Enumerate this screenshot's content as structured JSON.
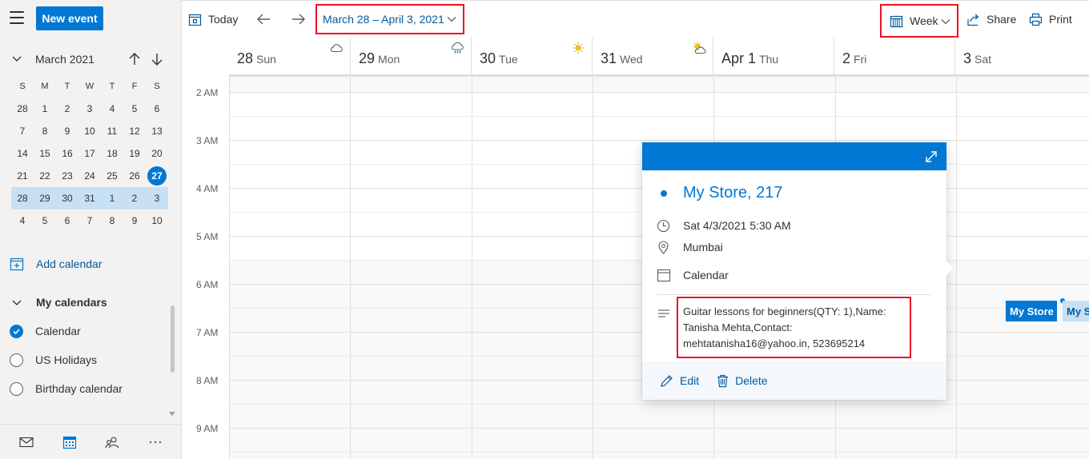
{
  "sidebar": {
    "new_event_label": "New event",
    "mini_month_title": "March 2021",
    "dow": [
      "S",
      "M",
      "T",
      "W",
      "T",
      "F",
      "S"
    ],
    "weeks": [
      [
        "28",
        "1",
        "2",
        "3",
        "4",
        "5",
        "6"
      ],
      [
        "7",
        "8",
        "9",
        "10",
        "11",
        "12",
        "13"
      ],
      [
        "14",
        "15",
        "16",
        "17",
        "18",
        "19",
        "20"
      ],
      [
        "21",
        "22",
        "23",
        "24",
        "25",
        "26",
        "27"
      ],
      [
        "28",
        "29",
        "30",
        "31",
        "1",
        "2",
        "3"
      ],
      [
        "4",
        "5",
        "6",
        "7",
        "8",
        "9",
        "10"
      ]
    ],
    "today": "27",
    "add_calendar_label": "Add calendar",
    "my_calendars_label": "My calendars",
    "calendars": [
      {
        "name": "Calendar",
        "checked": true
      },
      {
        "name": "US Holidays",
        "checked": false
      },
      {
        "name": "Birthday calendar",
        "checked": false
      }
    ]
  },
  "toolbar": {
    "today_label": "Today",
    "date_range": "March 28 – April 3, 2021",
    "view_label": "Week",
    "share_label": "Share",
    "print_label": "Print"
  },
  "week": {
    "days": [
      {
        "num": "28",
        "name": "Sun",
        "weather": "cloud-icon"
      },
      {
        "num": "29",
        "name": "Mon",
        "weather": "rain-cloud-icon"
      },
      {
        "num": "30",
        "name": "Tue",
        "weather": "sun-icon"
      },
      {
        "num": "31",
        "name": "Wed",
        "weather": "partly-sunny-icon"
      },
      {
        "num": "Apr 1",
        "name": "Thu",
        "weather": ""
      },
      {
        "num": "2",
        "name": "Fri",
        "weather": ""
      },
      {
        "num": "3",
        "name": "Sat",
        "weather": ""
      }
    ],
    "hours": [
      "2 AM",
      "3 AM",
      "4 AM",
      "5 AM",
      "6 AM",
      "7 AM",
      "8 AM",
      "9 AM"
    ]
  },
  "events": [
    {
      "label": "My Store"
    },
    {
      "label": "My Store"
    }
  ],
  "peek": {
    "title": "My Store, 217",
    "datetime": "Sat 4/3/2021 5:30 AM",
    "location": "Mumbai",
    "calendar": "Calendar",
    "description": "Guitar lessons for beginners(QTY: 1),Name: Tanisha Mehta,Contact: mehtatanisha16@yahoo.in, 523695214",
    "edit_label": "Edit",
    "delete_label": "Delete"
  },
  "colors": {
    "accent": "#0078d4",
    "highlight_border": "#e81123",
    "week_selection": "#c7e0f4"
  }
}
